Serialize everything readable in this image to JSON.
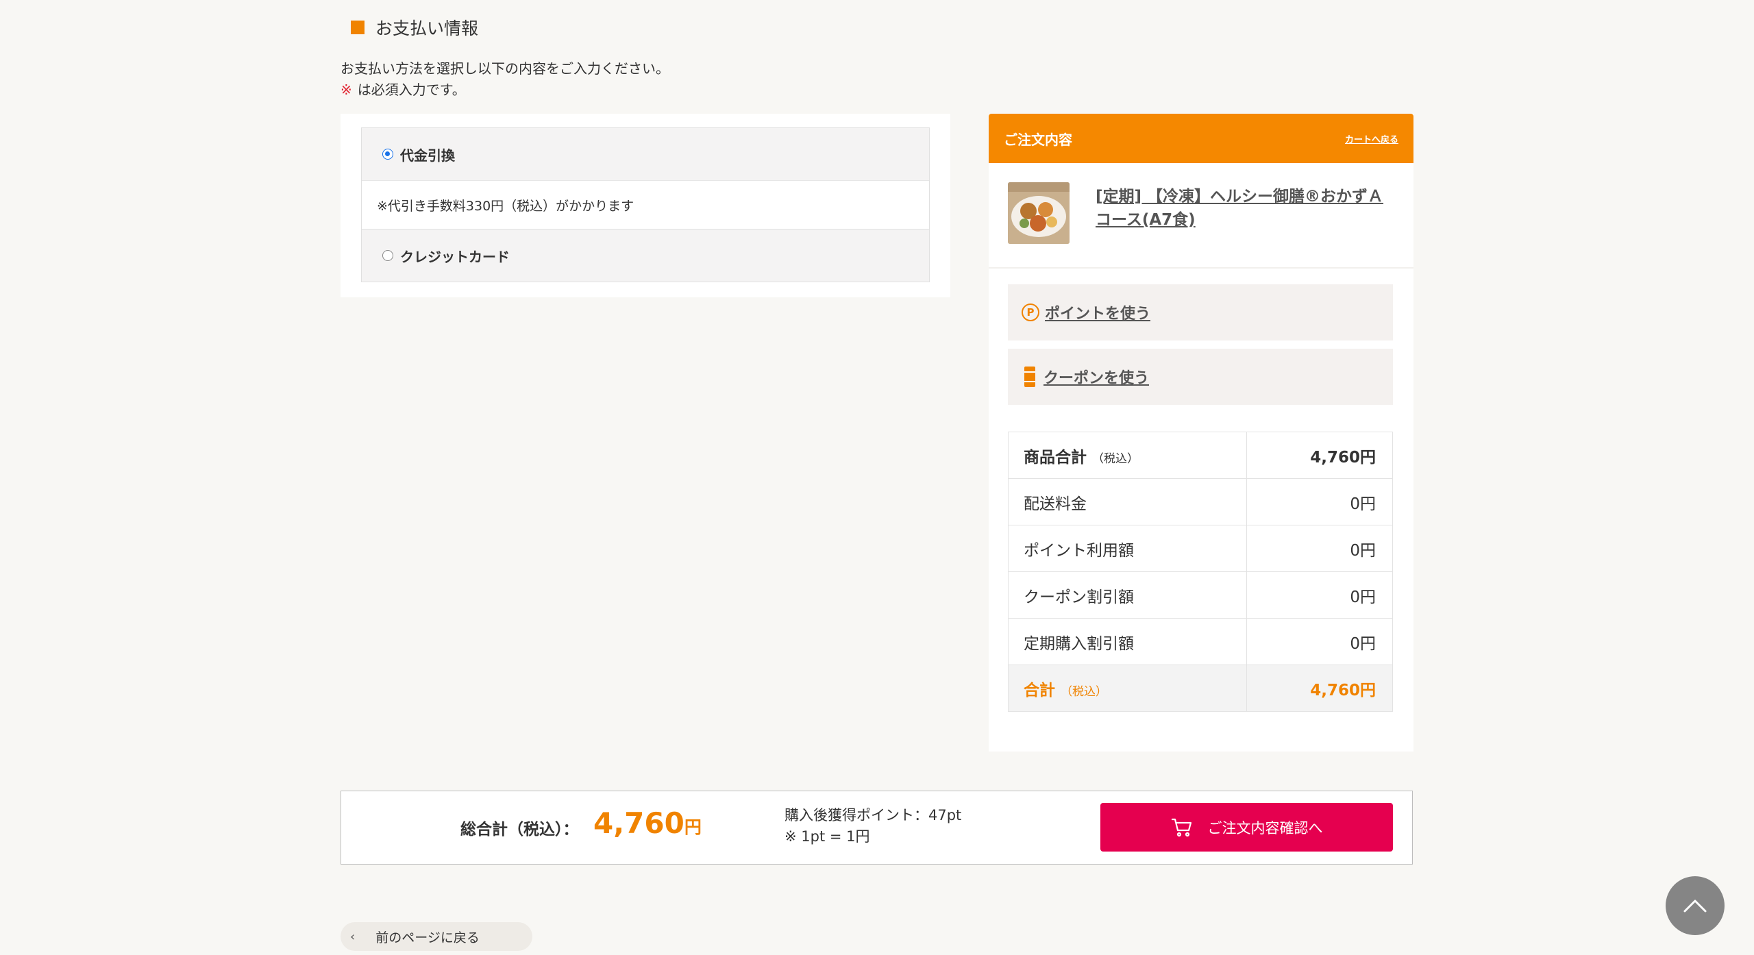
{
  "section": {
    "title": "お支払い情報"
  },
  "intro": {
    "line1": "お支払い方法を選択し以下の内容をご入力ください。",
    "required_mark": "※",
    "line2": "は必須入力です。"
  },
  "payment": {
    "options": [
      {
        "label": "代金引換",
        "selected": true,
        "note": "※代引き手数料330円（税込）がかかります"
      },
      {
        "label": "クレジットカード",
        "selected": false
      }
    ]
  },
  "order": {
    "header_title": "ご注文内容",
    "back_to_cart": "カートへ戻る",
    "product_name": "[定期] 【冷凍】ヘルシー御膳®おかずＡコース(A7食)",
    "use_points": "ポイントを使う",
    "point_icon_glyph": "P",
    "use_coupon": "クーポンを使う",
    "summary": [
      {
        "label": "商品合計",
        "tax": "（税込）",
        "value": "4,760円"
      },
      {
        "label": "配送料金",
        "value": "0円"
      },
      {
        "label": "ポイント利用額",
        "value": "0円"
      },
      {
        "label": "クーポン割引額",
        "value": "0円"
      },
      {
        "label": "定期購入割引額",
        "value": "0円"
      },
      {
        "label": "合計",
        "tax": "（税込）",
        "value": "4,760円"
      }
    ]
  },
  "bottom_bar": {
    "total_label": "総合計（税込）：",
    "total_value": "4,760",
    "total_unit": "円",
    "points_line1": "購入後獲得ポイント：47pt",
    "points_line2": "※ 1pt = 1円",
    "confirm_button": "ご注文内容確認へ"
  },
  "back_link": "前のページに戻る",
  "icons": {
    "scroll_top": "chevron-up-icon",
    "cart": "cart-icon",
    "back": "chevron-left-icon"
  },
  "colors": {
    "accent_orange": "#f58800",
    "cta_red": "#e5004f",
    "background": "#f8f7f4"
  }
}
